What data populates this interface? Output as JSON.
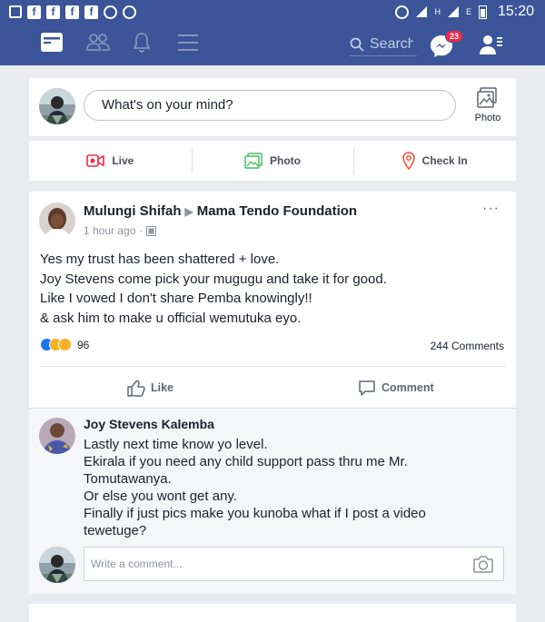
{
  "status_bar": {
    "time": "15:20",
    "network_label": "H",
    "network_label2": "E"
  },
  "nav": {
    "search_placeholder": "Search",
    "messenger_badge": "23"
  },
  "composer": {
    "placeholder": "What's on your mind?",
    "photo_label": "Photo"
  },
  "actions": {
    "live": "Live",
    "photo": "Photo",
    "checkin": "Check In"
  },
  "post": {
    "author": "Mulungi Shifah",
    "target": "Mama Tendo Foundation",
    "time": "1 hour ago",
    "lines": [
      "Yes my trust has been shattered + love.",
      "Joy Stevens come pick your mugugu and take it for good.",
      "Like I vowed I don't share Pemba knowingly!!",
      "& ask him to make u official wemutuka eyo."
    ],
    "reaction_count": "96",
    "comments_count": "244 Comments",
    "like_label": "Like",
    "comment_label": "Comment"
  },
  "comment": {
    "author": "Joy Stevens Kalemba",
    "lines": [
      "Lastly next time know yo level.",
      "Ekirala if you need any child support pass thru me Mr. Tomutawanya.",
      "Or else you wont get any.",
      "Finally if just pics make you kunoba what if I post a video tewetuge?"
    ]
  },
  "write_comment_placeholder": "Write a comment...",
  "colors": {
    "brand": "#3b5598",
    "badge": "#f02849",
    "live": "#f02849",
    "photo": "#45bd62",
    "checkin": "#f5533d"
  }
}
